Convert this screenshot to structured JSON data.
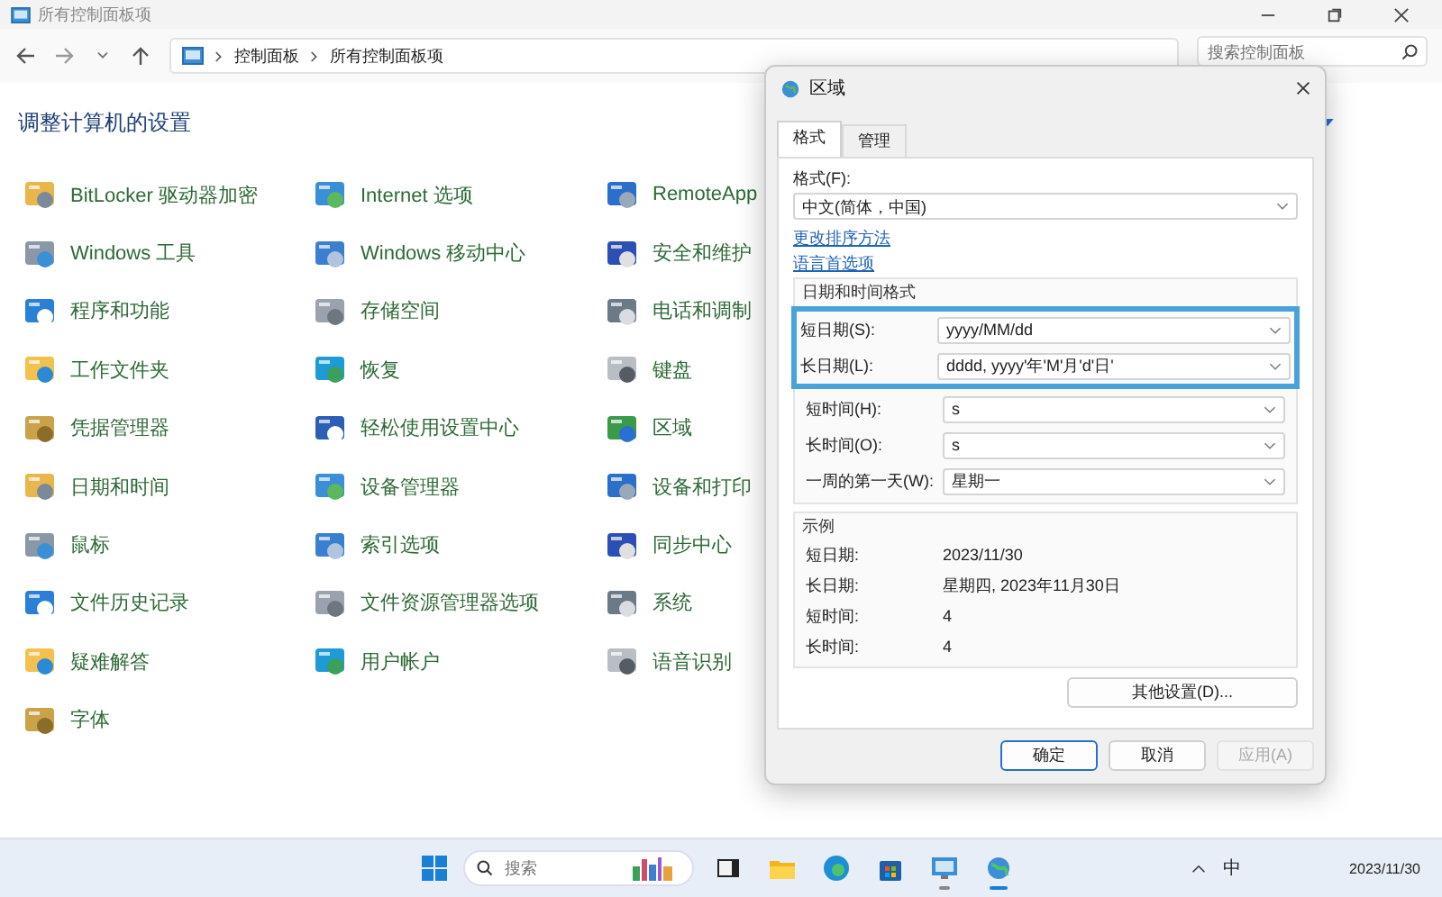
{
  "window": {
    "title": "所有控制面板项"
  },
  "address_bar": {
    "path": [
      "控制面板",
      "所有控制面板项"
    ]
  },
  "search": {
    "placeholder": "搜索控制面板"
  },
  "heading": "调整计算机的设置",
  "items": [
    {
      "label": "BitLocker 驱动器加密"
    },
    {
      "label": "Internet 选项"
    },
    {
      "label": "RemoteApp"
    },
    {
      "label": "Windows 工具"
    },
    {
      "label": "Windows 移动中心"
    },
    {
      "label": "安全和维护"
    },
    {
      "label": "程序和功能"
    },
    {
      "label": "存储空间"
    },
    {
      "label": "电话和调制"
    },
    {
      "label": "工作文件夹"
    },
    {
      "label": "恢复"
    },
    {
      "label": "键盘"
    },
    {
      "label": "凭据管理器"
    },
    {
      "label": "轻松使用设置中心"
    },
    {
      "label": "区域"
    },
    {
      "label": "日期和时间"
    },
    {
      "label": "设备管理器"
    },
    {
      "label": "设备和打印"
    },
    {
      "label": "鼠标"
    },
    {
      "label": "索引选项"
    },
    {
      "label": "同步中心"
    },
    {
      "label": "文件历史记录"
    },
    {
      "label": "文件资源管理器选项"
    },
    {
      "label": "系统"
    },
    {
      "label": "疑难解答"
    },
    {
      "label": "用户帐户"
    },
    {
      "label": "语音识别"
    },
    {
      "label": "字体"
    }
  ],
  "dialog": {
    "title": "区域",
    "tabs": [
      {
        "label": "格式",
        "selected": true
      },
      {
        "label": "管理",
        "selected": false
      }
    ],
    "format_label": "格式(F):",
    "format_value": "中文(简体，中国)",
    "links": [
      "更改排序方法",
      "语言首选项"
    ],
    "datetime_group": {
      "title": "日期和时间格式",
      "rows": [
        {
          "label": "短日期(S):",
          "value": "yyyy/MM/dd",
          "highlighted": true
        },
        {
          "label": "长日期(L):",
          "value": "dddd, yyyy'年'M'月'd'日'",
          "highlighted": true
        },
        {
          "label": "短时间(H):",
          "value": "s",
          "highlighted": false
        },
        {
          "label": "长时间(O):",
          "value": "s",
          "highlighted": false
        },
        {
          "label": "一周的第一天(W):",
          "value": "星期一",
          "highlighted": false
        }
      ]
    },
    "example_group": {
      "title": "示例",
      "rows": [
        {
          "label": "短日期:",
          "value": "2023/11/30"
        },
        {
          "label": "长日期:",
          "value": "星期四, 2023年11月30日"
        },
        {
          "label": "短时间:",
          "value": "4"
        },
        {
          "label": "长时间:",
          "value": "4"
        }
      ]
    },
    "more_button": "其他设置(D)...",
    "buttons": [
      {
        "label": "确定",
        "default": true,
        "disabled": false
      },
      {
        "label": "取消",
        "default": false,
        "disabled": false
      },
      {
        "label": "应用(A)",
        "default": false,
        "disabled": true
      }
    ]
  },
  "taskbar": {
    "search_placeholder": "搜索",
    "apps": [
      {
        "running": false
      },
      {
        "running": false
      },
      {
        "running": false
      },
      {
        "running": false
      },
      {
        "running": true
      },
      {
        "running": true
      }
    ],
    "ime": "中",
    "clock": "2023/11/30"
  }
}
